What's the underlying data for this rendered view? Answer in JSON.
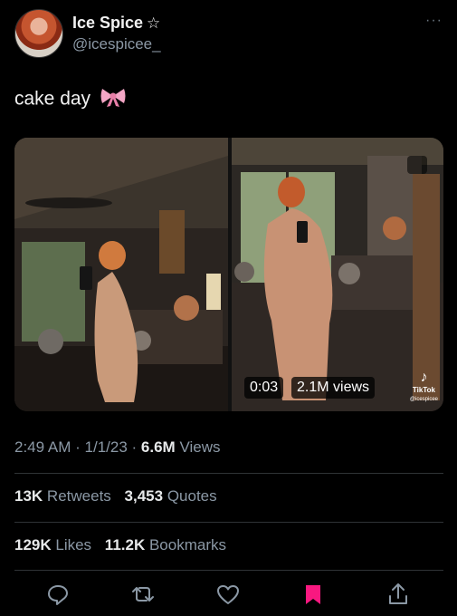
{
  "profile": {
    "name": "Ice Spice",
    "name_symbol": "☆",
    "handle": "@icespicee_",
    "more": "···"
  },
  "tweet": {
    "text": "cake day",
    "emoji_icon": "ribbon-bow-icon"
  },
  "media": {
    "video_duration": "0:03",
    "video_views": "2.1M views",
    "watermark_brand": "TikTok",
    "watermark_handle": "@icespicee"
  },
  "meta": {
    "time": "2:49 AM",
    "sep": "·",
    "date": "1/1/23",
    "views_count": "6.6M",
    "views_label": "Views"
  },
  "stats": {
    "retweets_count": "13K",
    "retweets_label": "Retweets",
    "quotes_count": "3,453",
    "quotes_label": "Quotes",
    "likes_count": "129K",
    "likes_label": "Likes",
    "bookmarks_count": "11.2K",
    "bookmarks_label": "Bookmarks"
  },
  "actions": [
    "reply-icon",
    "retweet-icon",
    "like-icon",
    "bookmark-icon",
    "share-icon"
  ],
  "colors": {
    "bookmark_active": "#f91880",
    "text_secondary": "#8b98a5",
    "divider": "#2f3336"
  }
}
